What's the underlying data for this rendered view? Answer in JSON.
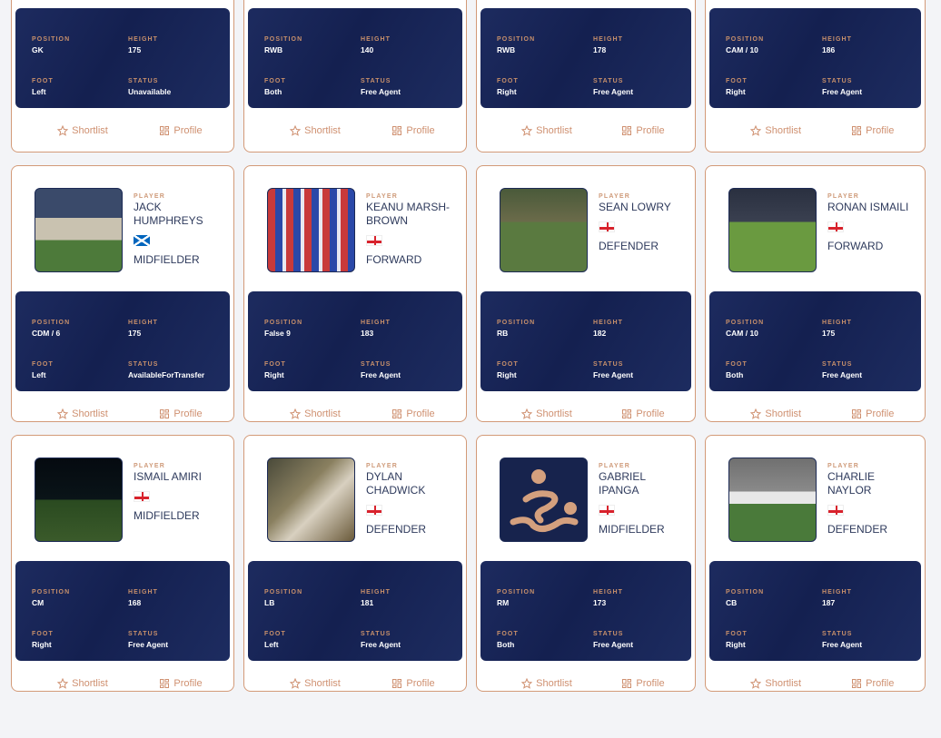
{
  "labels": {
    "player": "PLAYER",
    "position": "POSITION",
    "height": "HEIGHT",
    "foot": "FOOT",
    "status": "STATUS",
    "shortlist": "Shortlist",
    "profile": "Profile"
  },
  "colors": {
    "accent": "#cf9070",
    "panel": "#16224f",
    "border": "#d39a78"
  },
  "cards": [
    {
      "position": "GK",
      "height": "175",
      "foot": "Left",
      "status": "Unavailable"
    },
    {
      "position": "RWB",
      "height": "140",
      "foot": "Both",
      "status": "Free Agent"
    },
    {
      "position": "RWB",
      "height": "178",
      "foot": "Right",
      "status": "Free Agent"
    },
    {
      "position": "CAM / 10",
      "height": "186",
      "foot": "Right",
      "status": "Free Agent"
    },
    {
      "name": "JACK HUMPHREYS",
      "flag": "scotland",
      "role": "MIDFIELDER",
      "photo": "photo-red-kit",
      "position": "CDM / 6",
      "height": "175",
      "foot": "Left",
      "status": "AvailableForTransfer"
    },
    {
      "name": "KEANU MARSH-BROWN",
      "flag": "england",
      "role": "FORWARD",
      "photo": "photo-stands",
      "position": "False 9",
      "height": "183",
      "foot": "Right",
      "status": "Free Agent"
    },
    {
      "name": "SEAN LOWRY",
      "flag": "england",
      "role": "DEFENDER",
      "photo": "photo-pitch",
      "position": "RB",
      "height": "182",
      "foot": "Right",
      "status": "Free Agent"
    },
    {
      "name": "RONAN ISMAILI",
      "flag": "england",
      "role": "FORWARD",
      "photo": "photo-match",
      "position": "CAM / 10",
      "height": "175",
      "foot": "Both",
      "status": "Free Agent"
    },
    {
      "name": "ISMAIL AMIRI",
      "flag": "england",
      "role": "MIDFIELDER",
      "photo": "photo-night",
      "position": "CM",
      "height": "168",
      "foot": "Right",
      "status": "Free Agent"
    },
    {
      "name": "DYLAN CHADWICK",
      "flag": "england",
      "role": "DEFENDER",
      "photo": "photo-dugout",
      "position": "LB",
      "height": "181",
      "foot": "Left",
      "status": "Free Agent"
    },
    {
      "name": "GABRIEL IPANGA",
      "flag": "england",
      "role": "MIDFIELDER",
      "photo": "placeholder-logo",
      "position": "RM",
      "height": "173",
      "foot": "Both",
      "status": "Free Agent"
    },
    {
      "name": "CHARLIE NAYLOR",
      "flag": "england",
      "role": "DEFENDER",
      "photo": "photo-white-kit",
      "position": "CB",
      "height": "187",
      "foot": "Right",
      "status": "Free Agent"
    }
  ]
}
